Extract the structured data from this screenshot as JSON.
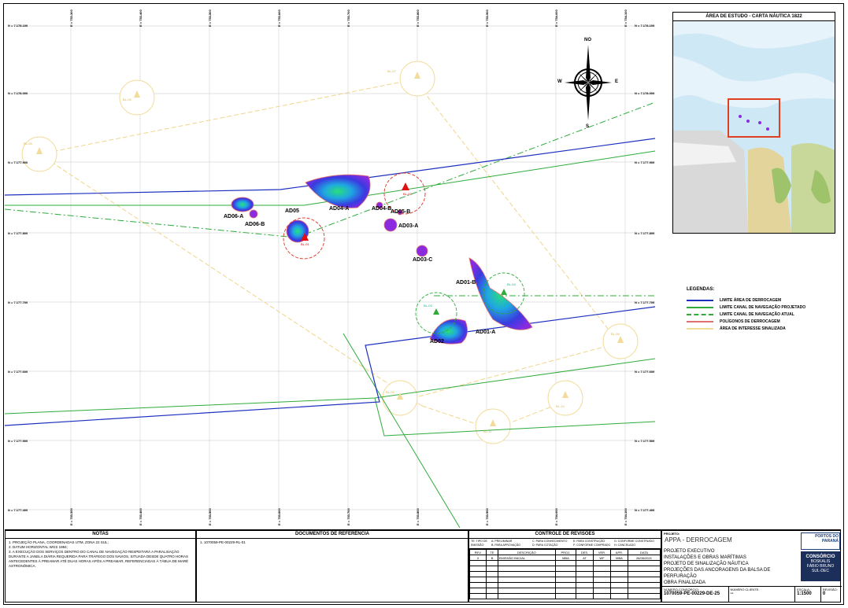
{
  "map": {
    "northing_ticks": [
      "N = 7.178.100",
      "N = 7.178.000",
      "N = 7.177.900",
      "N = 7.177.800",
      "N = 7.177.700",
      "N = 7.177.600",
      "N = 7.177.500",
      "N = 7.177.400"
    ],
    "easting_ticks": [
      "E = 753.300",
      "E = 753.400",
      "E = 753.500",
      "E = 753.600",
      "E = 753.700",
      "E = 753.800",
      "E = 753.900",
      "E = 754.000",
      "E = 754.100"
    ],
    "compass": {
      "n": "NO",
      "w": "W",
      "e": "E",
      "s": "S"
    },
    "areas": [
      "AD06-A",
      "AD06-B",
      "AD05",
      "AD04-A",
      "AD04-B",
      "AD05-B",
      "AD03-A",
      "AD03-C",
      "AD01-B",
      "AD01-A",
      "AD02"
    ],
    "red_buoys": [
      "BL-01",
      "BL-02"
    ],
    "green_buoys": [
      "BL-03",
      "BL-04"
    ],
    "yellow_buoys": [
      "BL-05",
      "BL-06",
      "BL-07",
      "BL-08",
      "BL-09",
      "BL-10",
      "BL-11"
    ]
  },
  "inset": {
    "title": "ÁREA DE ESTUDO - CARTA NÁUTICA 1822"
  },
  "legend": {
    "title": "LEGENDAS:",
    "items": [
      {
        "label": "LIMITE ÁREA DE DERROCAGEM",
        "color": "#1c2fbf",
        "style": "solid"
      },
      {
        "label": "LIMITE CANAL DE NAVEGAÇÃO  PROJETADO",
        "color": "#2eab3a",
        "style": "solid"
      },
      {
        "label": "LIMITE CANAL DE NAVEGAÇÃO  ATUAL",
        "color": "#2eab3a",
        "style": "dashdot"
      },
      {
        "label": "POLÍGONOS DE DERROCAGEM",
        "color": "#e07070",
        "style": "solid"
      },
      {
        "label": "ÁREA DE INTERESSE SINALIZADA",
        "color": "#f3dc9a",
        "style": "solid"
      }
    ]
  },
  "notes": {
    "title": "NOTAS",
    "items": [
      "1.   PROJEÇÃO PLANA, COORDENADAS UTM, ZONA 22 SUL;",
      "2.   DATUM HORIZONTAL WGS 1984;",
      "3.   A EXECUÇÃO DOS SERVIÇOS DENTRO DO CANAL DE NAVEGAÇÃO RESPEITARÁ A PARALISAÇÃO DURANTE A JANELA DIÁRIA REQUERIDA PARA TRÁFEGO DOS NAVIOS, SITUADA DESDE QUATRO HORAS ANTECEDENTES À PREAMAR ATÉ DUAS HORAS APÓS A PREAMAR, REFERENCIADAS À TÁBUA DE MARÉ ASTRONÔMICA."
    ]
  },
  "references": {
    "title": "DOCUMENTOS DE REFERÊNCIA",
    "items": [
      "1.   1070059-PE-00229-RL-01"
    ]
  },
  "revisions": {
    "title": "CONTROLE DE REVISÕES",
    "type_header": "TE: TIPO DE EMISSÃO",
    "types": [
      "A: PRELIMINAR",
      "B: PARA APROVAÇÃO",
      "C: PARA CONHECIMENTO",
      "D: PARA COTAÇÃO",
      "E: PARA CONSTRUÇÃO",
      "F: CONFORME COMPRADO",
      "G: CONFORME CONSTRUÍDO",
      "H: CANCELADO"
    ],
    "columns": [
      "REV.",
      "TE",
      "DESCRIÇÃO",
      "PROJ.",
      "DES.",
      "VER.",
      "APR.",
      "DATA"
    ],
    "rows": [
      [
        "0",
        "B",
        "EMISSÃO INICIAL",
        "MBA",
        "AT",
        "WF",
        "MBA",
        "26/06/2021"
      ]
    ]
  },
  "title_block": {
    "project_label": "PROJETO:",
    "project": "APPA - DERROCAGEM",
    "lines": [
      "PROJETO EXECUTIVO",
      "INSTALAÇÕES E OBRAS MARÍTIMAS",
      "PROJETO DE SINALIZAÇÃO NÁUTICA",
      "PROJEÇÕES DAS ANCORAGENS DA BALSA DE PERFURAÇÃO",
      "OBRA FINALIZADA"
    ],
    "number_label": "NÚMERO CONSÓRCIO:",
    "number": "1070059-PE-00229-DE-25",
    "client_label": "NÚMERO CLIENTE:",
    "client": "--",
    "scale_label": "ESCALA:",
    "scale": "1:1500",
    "rev_label": "REVISÃO:",
    "rev": "0",
    "logo1": "PORTOS DO PARANÁ",
    "logo2_title": "CONSÓRCIO",
    "logo2_lines": [
      "BOSKALIS",
      "FÁBIO BRUNO",
      "SUL-DEC"
    ]
  }
}
